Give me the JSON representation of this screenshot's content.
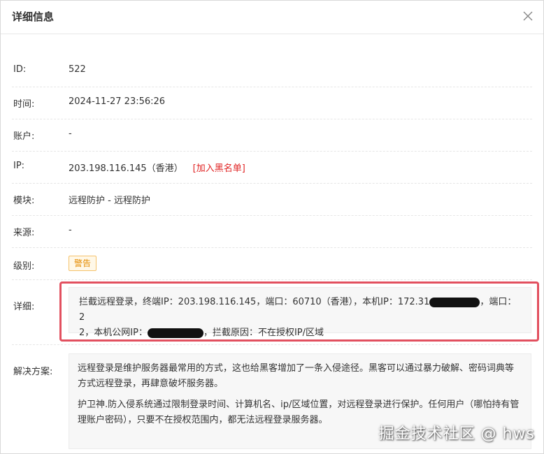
{
  "dialog": {
    "title": "详细信息"
  },
  "fields": {
    "id": {
      "label": "ID:",
      "value": "522"
    },
    "time": {
      "label": "时间:",
      "value": "2024-11-27 23:56:26"
    },
    "account": {
      "label": "账户:",
      "value": "-"
    },
    "ip": {
      "label": "IP:",
      "value": "203.198.116.145（香港）",
      "action": "[加入黑名单]"
    },
    "module": {
      "label": "模块:",
      "value": "远程防护 - 远程防护"
    },
    "source": {
      "label": "来源:",
      "value": "-"
    },
    "level": {
      "label": "级别:",
      "value": "警告"
    },
    "detail": {
      "label": "详细:",
      "line1_a": "拦截远程登录，终端IP：203.198.116.145，端口：60710（香港），本机IP：172.31",
      "line1_b": "，端口：2",
      "line2_a": "2，本机公网IP：",
      "line2_b": "，拦截原因：不在授权IP/区域"
    },
    "solution": {
      "label": "解决方案:",
      "para1": "远程登录是维护服务器最常用的方式，这也给黑客增加了一条入侵途径。黑客可以通过暴力破解、密码词典等方式远程登录，再肆意破坏服务器。",
      "para2": "护卫神.防入侵系统通过限制登录时间、计算机名、ip/区域位置，对远程登录进行保护。任何用户（哪怕持有管理账户密码），只要不在授权范围内，都无法远程登录服务器。"
    }
  },
  "watermark": "掘金技术社区 @ hws",
  "colors": {
    "link_red": "#e02424",
    "badge_orange": "#e48b00",
    "highlight_red": "#e2505f"
  },
  "icons": {
    "close": "close-icon"
  }
}
